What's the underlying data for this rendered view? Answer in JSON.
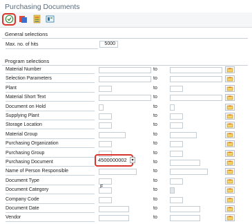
{
  "window": {
    "title": "Purchasing Documents"
  },
  "toolbar": {
    "buttons": [
      {
        "name": "execute-button",
        "icon": "execute-icon"
      },
      {
        "name": "get-variant-button",
        "icon": "get-variant-icon"
      },
      {
        "name": "list-button",
        "icon": "list-icon"
      },
      {
        "name": "info-button",
        "icon": "info-icon"
      }
    ]
  },
  "general": {
    "title": "General selections",
    "max_hits_label": "Max. no. of hits",
    "max_hits_value": "5000"
  },
  "program": {
    "title": "Program selections",
    "to_label": "to",
    "rows": [
      {
        "label": "Material Number"
      },
      {
        "label": "Selection Parameters"
      },
      {
        "label": "Plant"
      },
      {
        "label": "Material Short Text"
      },
      {
        "label": "Document on Hold"
      },
      {
        "label": "Supplying Plant"
      },
      {
        "label": "Storage Location"
      },
      {
        "label": "Material Group"
      },
      {
        "label": "Purchasing Organization"
      },
      {
        "label": "Purchasing Group"
      },
      {
        "label": "Purchasing Document",
        "value": "4500000002"
      },
      {
        "label": "Name of Person Responsible"
      },
      {
        "label": "Document Type"
      },
      {
        "label": "Document Category",
        "flag": "F"
      },
      {
        "label": "Company Code"
      },
      {
        "label": "Document Date"
      },
      {
        "label": "Vendor"
      }
    ]
  },
  "colors": {
    "highlight": "#d9342b",
    "title": "#5a6a7a",
    "toolbar_bg": "#f4f6f8"
  }
}
